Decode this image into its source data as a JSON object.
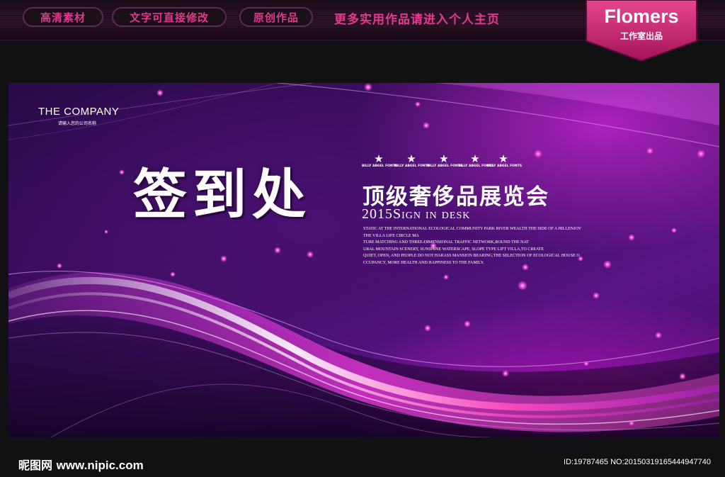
{
  "topbar": {
    "pills": [
      "高清素材",
      "文字可直接修改",
      "原创作品"
    ],
    "more_text": "更多实用作品请进入个人主页"
  },
  "badge": {
    "name": "Flomers",
    "subtitle": "工作室出品"
  },
  "banner": {
    "company": "THE COMPANY",
    "company_sub": "请输入您的公司名称",
    "main_title": "签到处",
    "subtitle": "顶级奢侈品展览会",
    "sign": "2015Sign in desk",
    "star_label": "BILLY ABGEL FONTS",
    "star_count": 5,
    "description": [
      "STATIC AT THE INTERNATIONAL ECOLOGICAL COMMUNITY PARK RIVER WEALTH THE SIDE OF A HILLENJOY",
      "THE VILLA LIFE CIRCLE MA",
      "TURE MATCHING AND THREE-DIMENSIONAL TRAFFIC NETWORK,ROUND THE NAT",
      "URAL MOUNTAIN SCENERY, SUNSHINE WATERSCAPE, SLOPE TYPE LIFT VILLA,TO CREATE",
      "QUIET, OPEN, AND PEOPLE DO NOT HARASS MANSION BEARING,THE SELECTION OF ECOLOGICAL HOUSE O",
      "CCUPANCY, MORE HEALTH AND HAPPINESS TO THE FAMILY."
    ]
  },
  "footer": {
    "logo_text": "昵图网",
    "site": "www.nipic.com",
    "id_text": "ID:19787465 NO:20150319165444947740"
  },
  "colors": {
    "accent": "#e0398c",
    "banner_base": "#3d0e62",
    "glow": "#e040e8"
  }
}
